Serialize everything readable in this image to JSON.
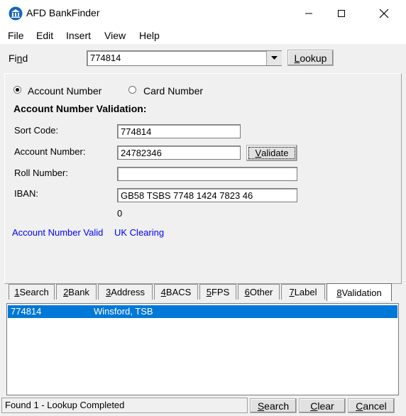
{
  "window": {
    "title": "AFD BankFinder",
    "minimize": "—",
    "maximize": "☐",
    "close": "✕"
  },
  "menu": [
    "File",
    "Edit",
    "Insert",
    "View",
    "Help"
  ],
  "find": {
    "label_pre": "Fi",
    "label_u": "n",
    "label_post": "d",
    "value": "774814",
    "lookup_u": "L",
    "lookup_rest": "ookup"
  },
  "mode": {
    "account": "Account Number",
    "card": "Card Number",
    "selected": "account"
  },
  "section_title": "Account Number Validation:",
  "fields": {
    "sort_code_label": "Sort Code:",
    "sort_code": "774814",
    "account_label": "Account Number:",
    "account": "24782346",
    "validate_u": "V",
    "validate_rest": "alidate",
    "roll_label": "Roll Number:",
    "roll": "",
    "iban_label": "IBAN:",
    "iban": "GB58 TSBS 7748 1424 7823 46",
    "iban_extra": "0"
  },
  "result": {
    "valid": "Account Number Valid",
    "clearing": "UK Clearing",
    "color": "#0000ff"
  },
  "tabs": [
    {
      "u": "1",
      "rest": " Search"
    },
    {
      "u": "2",
      "rest": " Bank"
    },
    {
      "u": "3",
      "rest": " Address"
    },
    {
      "u": "4",
      "rest": " BACS"
    },
    {
      "u": "5",
      "rest": " FPS"
    },
    {
      "u": "6",
      "rest": " Other"
    },
    {
      "u": "7",
      "rest": " Label"
    },
    {
      "u": "8",
      "rest": " Validation"
    }
  ],
  "list": [
    {
      "code": "774814",
      "name": "Winsford, TSB"
    }
  ],
  "status": "Found 1 - Lookup Completed",
  "buttons": {
    "search_u": "S",
    "search_rest": "earch",
    "clear_u": "C",
    "clear_rest": "lear",
    "cancel_u": "C",
    "cancel_rest": "ancel"
  }
}
